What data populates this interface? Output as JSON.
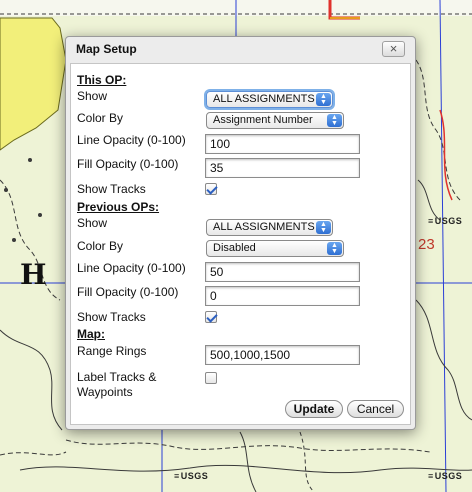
{
  "dialog": {
    "title": "Map Setup",
    "close_label": "×",
    "this_op": {
      "heading": "This OP:",
      "show_label": "Show",
      "show_value": "ALL ASSIGNMENTS",
      "color_by_label": "Color By",
      "color_by_value": "Assignment Number",
      "line_opacity_label": "Line Opacity (0-100)",
      "line_opacity_value": "100",
      "fill_opacity_label": "Fill Opacity (0-100)",
      "fill_opacity_value": "35",
      "show_tracks_label": "Show Tracks",
      "show_tracks_checked": true
    },
    "previous_ops": {
      "heading": "Previous OPs:",
      "show_label": "Show",
      "show_value": "ALL ASSIGNMENTS",
      "color_by_label": "Color By",
      "color_by_value": "Disabled",
      "line_opacity_label": "Line Opacity (0-100)",
      "line_opacity_value": "50",
      "fill_opacity_label": "Fill Opacity (0-100)",
      "fill_opacity_value": "0",
      "show_tracks_label": "Show Tracks",
      "show_tracks_checked": true
    },
    "map": {
      "heading": "Map:",
      "range_rings_label": "Range Rings",
      "range_rings_value": "500,1000,1500",
      "label_tracks_label_line1": "Label Tracks &",
      "label_tracks_label_line2": "Waypoints",
      "label_tracks_checked": false
    },
    "update_label": "Update",
    "cancel_label": "Cancel"
  },
  "map_background": {
    "usgs_label": "USGS",
    "letter": "H",
    "number": "23",
    "colors": {
      "background": "#eef3d6",
      "yellow_area": "#f2ef7a",
      "grid_line": "#2b3fd6",
      "contour": "#3a3a3a",
      "road": "#e0322c"
    }
  }
}
